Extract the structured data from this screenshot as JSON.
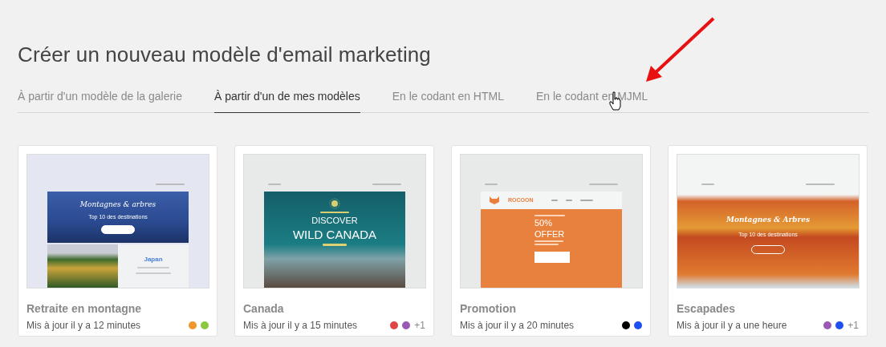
{
  "page_title": "Créer un nouveau modèle d'email marketing",
  "tabs": [
    {
      "label": "À partir d'un modèle de la galerie",
      "selected": false,
      "hovered": false
    },
    {
      "label": "À partir d'un de mes modèles",
      "selected": true,
      "hovered": false
    },
    {
      "label": "En le codant en HTML",
      "selected": false,
      "hovered": false
    },
    {
      "label": "En le codant en MJML",
      "selected": false,
      "hovered": true
    }
  ],
  "templates": [
    {
      "name": "Retraite en montagne",
      "updated": "Mis à jour il y a 12 minutes",
      "colors": [
        {
          "color": "#f0962a"
        },
        {
          "color": "#8dc63f"
        }
      ],
      "preview": {
        "kind": "split",
        "heading": "Montagnes & arbres",
        "subheading": "Top 10 des destinations",
        "side_title": "Japan"
      }
    },
    {
      "name": "Canada",
      "updated": "Mis à jour il y a 15 minutes",
      "colors": [
        {
          "color": "#e04646"
        },
        {
          "color": "#9b59b6"
        }
      ],
      "more": "+1",
      "preview": {
        "kind": "travel",
        "heading": "DISCOVER",
        "subheading": "WILD CANADA"
      }
    },
    {
      "name": "Promotion",
      "updated": "Mis à jour il y a 20 minutes",
      "colors": [
        {
          "color": "#000000"
        },
        {
          "color": "#1e4ff0"
        }
      ],
      "preview": {
        "kind": "promo",
        "brand": "ROCOON",
        "heading": "50%",
        "subheading": "OFFER"
      }
    },
    {
      "name": "Escapades",
      "updated": "Mis à jour il y a une heure",
      "colors": [
        {
          "color": "#9b59b6"
        },
        {
          "color": "#1e4ff0"
        }
      ],
      "more": "+1",
      "preview": {
        "kind": "autumn",
        "heading": "Montagnes & Arbres",
        "subheading": "Top 10 des destinations"
      }
    }
  ]
}
